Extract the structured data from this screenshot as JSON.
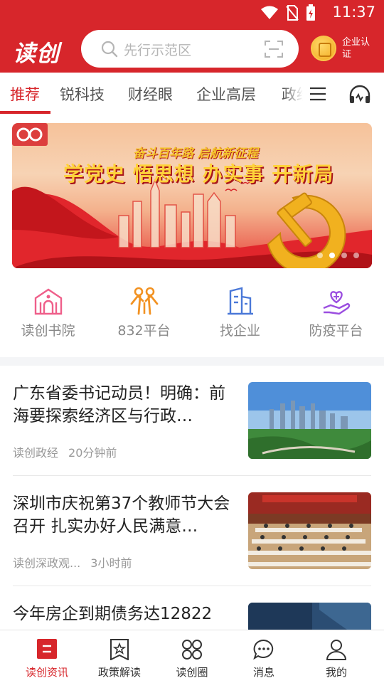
{
  "status_bar": {
    "time": "11:37"
  },
  "header": {
    "logo": "读创",
    "search_placeholder": "先行示范区",
    "enterprise_label": "企业认证"
  },
  "tabs": [
    {
      "label": "推荐",
      "active": true
    },
    {
      "label": "锐科技",
      "active": false
    },
    {
      "label": "财经眼",
      "active": false
    },
    {
      "label": "企业高层",
      "active": false
    },
    {
      "label": "政经",
      "active": false
    }
  ],
  "banner": {
    "subtitle": "奋斗百年路 启航新征程",
    "title": "学党史 悟思想 办实事 开新局",
    "slide_count": 4,
    "active_slide": 1
  },
  "quick_entries": [
    {
      "label": "读创书院",
      "icon": "academy-icon",
      "color": "#ef5f8a"
    },
    {
      "label": "832平台",
      "icon": "people-icon",
      "color": "#f29222"
    },
    {
      "label": "找企业",
      "icon": "building-icon",
      "color": "#4a78d8"
    },
    {
      "label": "防疫平台",
      "icon": "hand-heart-icon",
      "color": "#9b4ee0"
    }
  ],
  "news": [
    {
      "title": "广东省委书记动员！明确：前海要探索经济区与行政…",
      "source": "读创政经",
      "time": "20分钟前",
      "thumb": "city-skyline-thumbnail"
    },
    {
      "title": "深圳市庆祝第37个教师节大会召开 扎实办好人民满意…",
      "source": "读创深政观...",
      "time": "3小时前",
      "thumb": "meeting-hall-thumbnail"
    },
    {
      "title": "今年房企到期债务达12822",
      "source": "",
      "time": "",
      "thumb": "document-thumbnail"
    }
  ],
  "bottom_nav": [
    {
      "label": "读创资讯",
      "icon": "news-icon",
      "active": true
    },
    {
      "label": "政策解读",
      "icon": "policy-star-icon",
      "active": false
    },
    {
      "label": "读创圈",
      "icon": "circle-grid-icon",
      "active": false
    },
    {
      "label": "消息",
      "icon": "message-icon",
      "active": false
    },
    {
      "label": "我的",
      "icon": "profile-icon",
      "active": false
    }
  ],
  "colors": {
    "brand_red": "#d7262b",
    "text_gray": "#999999"
  }
}
